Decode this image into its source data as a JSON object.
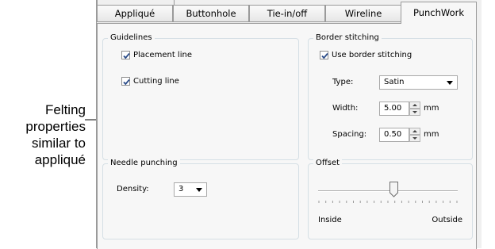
{
  "annotation": {
    "lines": [
      "Felting",
      "properties",
      "similar to",
      "appliqué"
    ]
  },
  "tabs": [
    {
      "label": "Appliqué",
      "active": false
    },
    {
      "label": "Buttonhole",
      "active": false
    },
    {
      "label": "Tie-in/off",
      "active": false
    },
    {
      "label": "Wireline",
      "active": false
    },
    {
      "label": "PunchWork",
      "active": true
    }
  ],
  "guidelines": {
    "title": "Guidelines",
    "placement_line": {
      "label": "Placement line",
      "checked": true
    },
    "cutting_line": {
      "label": "Cutting line",
      "checked": true
    }
  },
  "border_stitching": {
    "title": "Border stitching",
    "use_border": {
      "label": "Use border stitching",
      "checked": true
    },
    "type_label": "Type:",
    "type_value": "Satin",
    "width_label": "Width:",
    "width_value": "5.00",
    "width_unit": "mm",
    "spacing_label": "Spacing:",
    "spacing_value": "0.50",
    "spacing_unit": "mm"
  },
  "needle_punching": {
    "title": "Needle punching",
    "density_label": "Density:",
    "density_value": "3"
  },
  "offset": {
    "title": "Offset",
    "left_label": "Inside",
    "right_label": "Outside",
    "level": 0.54
  },
  "colors": {
    "checkmark": "#2c4d8a",
    "border": "#9a9a9a",
    "group_border": "#d5dfe5"
  }
}
